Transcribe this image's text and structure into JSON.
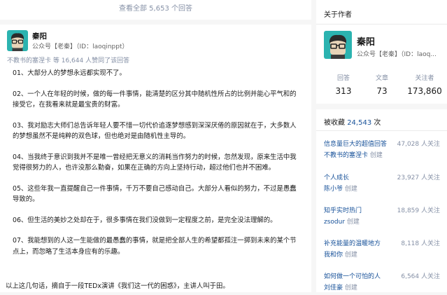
{
  "view_all": "查看全部 5,653 个回答",
  "answer": {
    "author": {
      "name": "秦阳",
      "bio": "公众号【老秦】（ID：laoqinppt）"
    },
    "voters": "不教书的塞涅卡 等 16,644 人赞同了该回答",
    "paragraphs": [
      "01、大部分人的梦想永远都实现不了。",
      "02、一个人在年轻的时候，做的每一件事情，能清楚的区分其中随机性所占的比例并能心平气和的接受它，在我看来就是最宝贵的财富。",
      "03、我对励志大师们总告诉年轻人要不惜一切代价追逐梦想感到深深厌倦的原因就在于，大多数人的梦想虽然不是纯粹的双色球，但也绝对是由随机性主导的。",
      "04、当我终于意识到我并不是唯一曾经把无意义的消耗当作努力的时候，忽然发现，原来生活中我觉得很努力的人，也许没那么勤奋，如果在正确的方向上坚持行动，超过他们也并不困难。",
      "05、这些年我一直提醒自己一件事情，千万不要自己感动自己。大部分人看似的努力，不过是愚蠢导致的。",
      "06、但生活的美妙之处却在于，很多事情在我们没做到一定程度之前，是完全没法理解的。",
      "07、我能想到的人这一生能做的最愚蠢的事情，就是把全部人生的希望都孤注一掷到未来的某个节点上，而忽略了生活本身应有的乐趣。"
    ],
    "closing": "以上这几句话，摘自于一段TEDx演讲《我们这一代的困惑》，主讲人叫于田。"
  },
  "sidebar": {
    "about_title": "关于作者",
    "author_name": "秦阳",
    "author_bio": "公众号【老秦】（ID：laoq...",
    "stats": [
      {
        "label": "回答",
        "value": "313"
      },
      {
        "label": "文章",
        "value": "73"
      },
      {
        "label": "关注者",
        "value": "173,860"
      }
    ],
    "collect_prefix": "被收藏",
    "collect_count": "24,543",
    "collect_suffix": "次",
    "collections": [
      {
        "title": "信息量巨大的超值回答",
        "user": "不教书的塞涅卡",
        "action": "创建",
        "count": "47,028 人关注"
      },
      {
        "title": "个人成长",
        "user": "陈小爷",
        "action": "创建",
        "count": "23,927 人关注"
      },
      {
        "title": "知乎实时热门",
        "user": "zsodur",
        "action": "创建",
        "count": "18,859 人关注"
      },
      {
        "title": "补充能量的温暖地方",
        "user": "我和你",
        "action": "创建",
        "count": "8,118 人关注"
      },
      {
        "title": "如何做一个可怕的人",
        "user": "刘佳豪",
        "action": "创建",
        "count": "6,564 人关注"
      }
    ]
  },
  "colors": {
    "link": "#175199",
    "muted": "#8590a6",
    "background": "#f6f6f6"
  },
  "icons": {
    "avatar": "avatar-glasses-cartoon"
  }
}
